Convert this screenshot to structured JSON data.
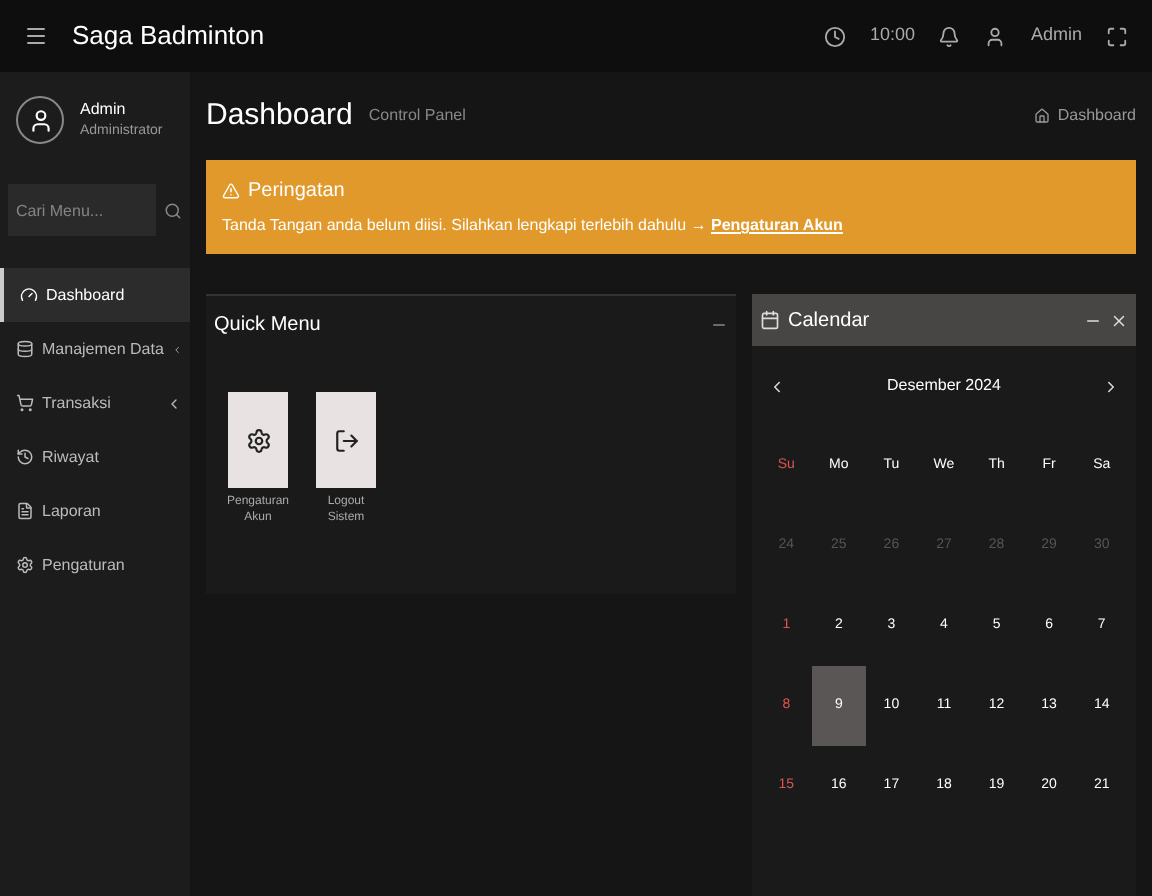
{
  "topbar": {
    "title": "Saga Badminton",
    "clock": "10:00",
    "user": "Admin"
  },
  "sidebar": {
    "user_name": "Admin",
    "user_role": "Administrator",
    "search": {
      "placeholder": "Cari Menu..."
    },
    "items": [
      {
        "label": "Dashboard",
        "selected": true,
        "expandable": false
      },
      {
        "label": "Manajemen Data",
        "selected": false,
        "expandable": true
      },
      {
        "label": "Transaksi",
        "selected": false,
        "expandable": true
      },
      {
        "label": "Riwayat",
        "selected": false,
        "expandable": false
      },
      {
        "label": "Laporan",
        "selected": false,
        "expandable": false
      },
      {
        "label": "Pengaturan",
        "selected": false,
        "expandable": false
      }
    ]
  },
  "header": {
    "title": "Dashboard",
    "subtitle": "Control Panel",
    "breadcrumb": "Dashboard"
  },
  "alert": {
    "title": "Peringatan",
    "text": "Tanda Tangan anda belum diisi. Silahkan lengkapi terlebih dahulu →",
    "link": "Pengaturan Akun"
  },
  "quick_menu": {
    "title": "Quick Menu",
    "tiles": [
      {
        "label": "Pengaturan Akun",
        "kind": "gear"
      },
      {
        "label": "Logout Sistem",
        "kind": "logout"
      }
    ]
  },
  "calendar": {
    "title": "Calendar",
    "month": "Desember 2024",
    "weekdays": [
      "Su",
      "Mo",
      "Tu",
      "We",
      "Th",
      "Fr",
      "Sa"
    ],
    "weeks": [
      {
        "dim": true,
        "days": [
          {
            "label": "24",
            "selected": false
          },
          {
            "label": "25",
            "selected": false
          },
          {
            "label": "26",
            "selected": false
          },
          {
            "label": "27",
            "selected": false
          },
          {
            "label": "28",
            "selected": false
          },
          {
            "label": "29",
            "selected": false
          },
          {
            "label": "30",
            "selected": false
          }
        ]
      },
      {
        "dim": false,
        "days": [
          {
            "label": "1",
            "selected": false
          },
          {
            "label": "2",
            "selected": false
          },
          {
            "label": "3",
            "selected": false
          },
          {
            "label": "4",
            "selected": false
          },
          {
            "label": "5",
            "selected": false
          },
          {
            "label": "6",
            "selected": false
          },
          {
            "label": "7",
            "selected": false
          }
        ]
      },
      {
        "dim": false,
        "days": [
          {
            "label": "8",
            "selected": false
          },
          {
            "label": "9",
            "selected": true
          },
          {
            "label": "10",
            "selected": false
          },
          {
            "label": "11",
            "selected": false
          },
          {
            "label": "12",
            "selected": false
          },
          {
            "label": "13",
            "selected": false
          },
          {
            "label": "14",
            "selected": false
          }
        ]
      },
      {
        "dim": false,
        "days": [
          {
            "label": "15",
            "selected": false
          },
          {
            "label": "16",
            "selected": false
          },
          {
            "label": "17",
            "selected": false
          },
          {
            "label": "18",
            "selected": false
          },
          {
            "label": "19",
            "selected": false
          },
          {
            "label": "20",
            "selected": false
          },
          {
            "label": "21",
            "selected": false
          }
        ]
      }
    ]
  }
}
